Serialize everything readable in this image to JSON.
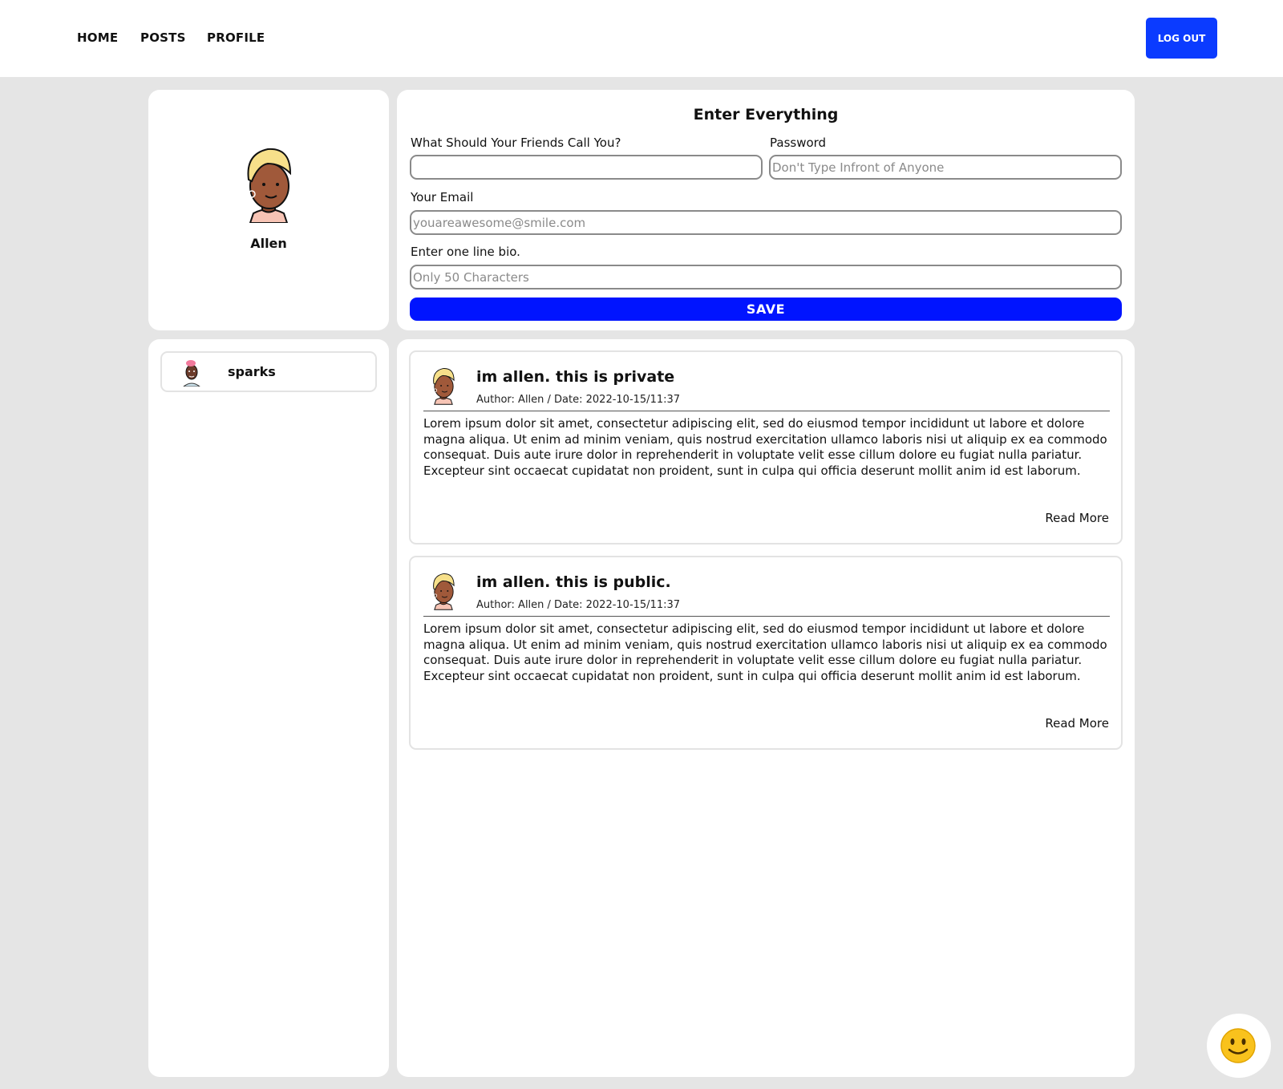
{
  "nav": {
    "links": [
      {
        "label": "HOME"
      },
      {
        "label": "POSTS"
      },
      {
        "label": "PROFILE"
      }
    ],
    "logout_label": "LOG OUT",
    "logout_color": "#0b3bff"
  },
  "profile": {
    "name": "Allen",
    "avatar_icon": "avatar-woman-blonde-icon"
  },
  "form": {
    "title": "Enter Everything",
    "name_label": "What Should Your Friends Call You?",
    "name_value": "",
    "password_label": "Password",
    "password_placeholder": "Don't Type Infront of Anyone",
    "email_label": "Your Email",
    "email_placeholder": "youareawesome@smile.com",
    "bio_label": "Enter one line bio.",
    "bio_placeholder": "Only 50 Characters",
    "save_label": "SAVE",
    "save_color": "#0014ff"
  },
  "friends": [
    {
      "name": "sparks",
      "avatar_icon": "avatar-man-pink-hair-icon"
    }
  ],
  "posts": [
    {
      "title": "im allen. this is private",
      "meta": "Author: Allen / Date: 2022-10-15/11:37",
      "body": "Lorem ipsum dolor sit amet, consectetur adipiscing elit, sed do eiusmod tempor incididunt ut labore et dolore magna aliqua. Ut enim ad minim veniam, quis nostrud exercitation ullamco laboris nisi ut aliquip ex ea commodo consequat. Duis aute irure dolor in reprehenderit in voluptate velit esse cillum dolore eu fugiat nulla pariatur. Excepteur sint occaecat cupidatat non proident, sunt in culpa qui officia deserunt mollit anim id est laborum.",
      "read_more": "Read More"
    },
    {
      "title": "im allen. this is public.",
      "meta": "Author: Allen / Date: 2022-10-15/11:37",
      "body": "Lorem ipsum dolor sit amet, consectetur adipiscing elit, sed do eiusmod tempor incididunt ut labore et dolore magna aliqua. Ut enim ad minim veniam, quis nostrud exercitation ullamco laboris nisi ut aliquip ex ea commodo consequat. Duis aute irure dolor in reprehenderit in voluptate velit esse cillum dolore eu fugiat nulla pariatur. Excepteur sint occaecat cupidatat non proident, sunt in culpa qui officia deserunt mollit anim id est laborum.",
      "read_more": "Read More"
    }
  ],
  "widget": {
    "icon": "smiley-face-icon"
  }
}
